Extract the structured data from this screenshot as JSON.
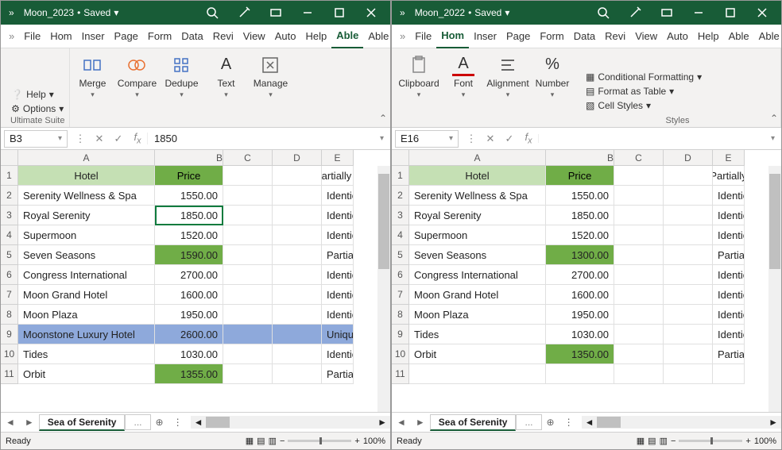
{
  "pane1": {
    "title": "Moon_2023",
    "saved": "Saved",
    "tabs": [
      "File",
      "Hom",
      "Inser",
      "Page",
      "Form",
      "Data",
      "Revi",
      "View",
      "Auto",
      "Help",
      "Able",
      "Able"
    ],
    "active_tab": 10,
    "help_label": "Help",
    "options_label": "Options",
    "suite_name": "Ultimate Suite",
    "groups": [
      {
        "label": "Merge"
      },
      {
        "label": "Compare"
      },
      {
        "label": "Dedupe"
      },
      {
        "label": "Text"
      },
      {
        "label": "Manage"
      }
    ],
    "name_box": "B3",
    "formula": "1850",
    "cols": [
      "A",
      "B",
      "C",
      "D",
      "E"
    ],
    "header_row": {
      "A": "Hotel",
      "B": "Price"
    },
    "rows": [
      {
        "n": 2,
        "A": "Serenity Wellness & Spa",
        "B": "1550.00",
        "E": "Identical"
      },
      {
        "n": 3,
        "A": "Royal Serenity",
        "B": "1850.00",
        "E": "Identical",
        "sel": true
      },
      {
        "n": 4,
        "A": "Supermoon",
        "B": "1520.00",
        "E": "Identical"
      },
      {
        "n": 5,
        "A": "Seven Seasons",
        "B": "1590.00",
        "E": "Partially d",
        "greenB": true
      },
      {
        "n": 6,
        "A": "Congress International",
        "B": "2700.00",
        "E": "Identical"
      },
      {
        "n": 7,
        "A": "Moon Grand Hotel",
        "B": "1600.00",
        "E": "Identical"
      },
      {
        "n": 8,
        "A": "Moon Plaza",
        "B": "1950.00",
        "E": "Identical"
      },
      {
        "n": 9,
        "A": "Moonstone Luxury Hotel",
        "B": "2600.00",
        "E": "Unique",
        "blue": true
      },
      {
        "n": 10,
        "A": "Tides",
        "B": "1030.00",
        "E": "Identical"
      },
      {
        "n": 11,
        "A": "Orbit",
        "B": "1355.00",
        "E": "Partially d",
        "greenB": true
      }
    ],
    "partial_e1": "Partially d",
    "sheet": "Sea of Serenity",
    "hidden_sheet": "...",
    "status": "Ready",
    "zoom": "100%"
  },
  "pane2": {
    "title": "Moon_2022",
    "saved": "Saved",
    "tabs": [
      "File",
      "Hom",
      "Inser",
      "Page",
      "Form",
      "Data",
      "Revi",
      "View",
      "Auto",
      "Help",
      "Able",
      "Able"
    ],
    "active_tab": 1,
    "clipboard": "Clipboard",
    "font": "Font",
    "align": "Alignment",
    "number": "Number",
    "cf": "Conditional Formatting",
    "fat": "Format as Table",
    "cs": "Cell Styles",
    "styles_name": "Styles",
    "name_box": "E16",
    "formula": "",
    "cols": [
      "A",
      "B",
      "C",
      "D",
      "E"
    ],
    "header_row": {
      "A": "Hotel",
      "B": "Price"
    },
    "rows": [
      {
        "n": 2,
        "A": "Serenity Wellness & Spa",
        "B": "1550.00",
        "E": "Identical"
      },
      {
        "n": 3,
        "A": "Royal Serenity",
        "B": "1850.00",
        "E": "Identical"
      },
      {
        "n": 4,
        "A": "Supermoon",
        "B": "1520.00",
        "E": "Identical"
      },
      {
        "n": 5,
        "A": "Seven Seasons",
        "B": "1300.00",
        "E": "Partially d",
        "greenB": true
      },
      {
        "n": 6,
        "A": "Congress International",
        "B": "2700.00",
        "E": "Identical"
      },
      {
        "n": 7,
        "A": "Moon Grand Hotel",
        "B": "1600.00",
        "E": "Identical"
      },
      {
        "n": 8,
        "A": "Moon Plaza",
        "B": "1950.00",
        "E": "Identical"
      },
      {
        "n": 9,
        "A": "Tides",
        "B": "1030.00",
        "E": "Identical"
      },
      {
        "n": 10,
        "A": "Orbit",
        "B": "1350.00",
        "E": "Partially d",
        "greenB": true
      },
      {
        "n": 11,
        "A": "",
        "B": "",
        "E": ""
      }
    ],
    "partial_e1": "Partially",
    "sheet": "Sea of Serenity",
    "hidden_sheet": "...",
    "status": "Ready",
    "zoom": "100%"
  }
}
